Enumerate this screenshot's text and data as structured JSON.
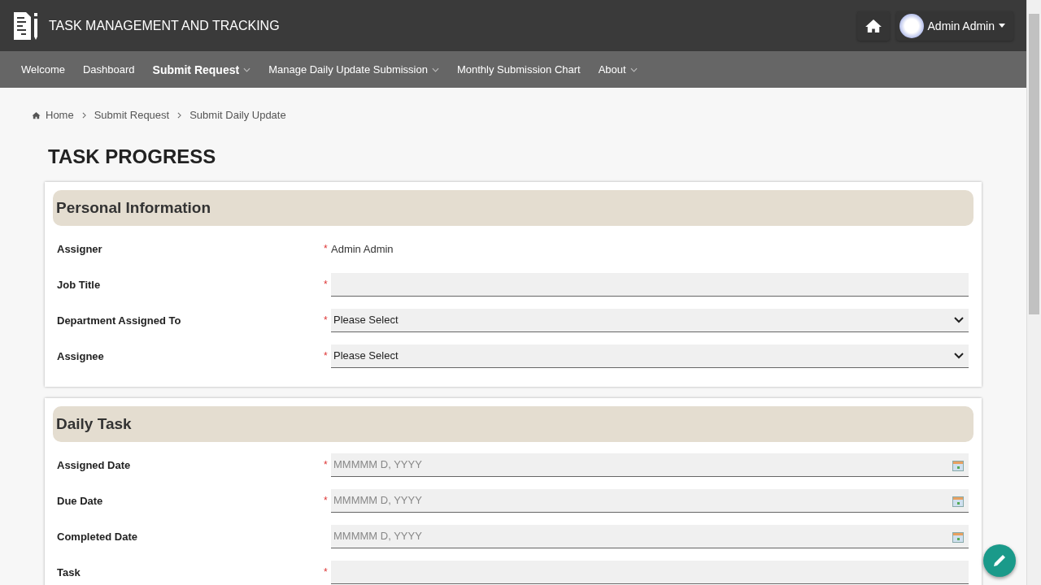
{
  "header": {
    "title": "TASK MANAGEMENT AND TRACKING",
    "user": "Admin Admin"
  },
  "nav": [
    {
      "label": "Welcome",
      "selected": false,
      "dropdown": false
    },
    {
      "label": "Dashboard",
      "selected": false,
      "dropdown": false
    },
    {
      "label": "Submit Request",
      "selected": true,
      "dropdown": true
    },
    {
      "label": "Manage Daily Update Submission",
      "selected": false,
      "dropdown": true
    },
    {
      "label": "Monthly Submission Chart",
      "selected": false,
      "dropdown": false
    },
    {
      "label": "About",
      "selected": false,
      "dropdown": true
    }
  ],
  "breadcrumb": [
    "Home",
    "Submit Request",
    "Submit Daily Update"
  ],
  "page_title": "TASK PROGRESS",
  "sections": [
    {
      "title": "Personal Information",
      "fields": [
        {
          "label": "Assigner",
          "mark": "*",
          "kind": "static",
          "value": "Admin Admin"
        },
        {
          "label": "Job Title",
          "mark": "*",
          "kind": "text"
        },
        {
          "label": "Department Assigned To",
          "mark": "*",
          "kind": "select",
          "value": "Please Select"
        },
        {
          "label": "Assignee",
          "mark": "*",
          "kind": "select",
          "value": "Please Select"
        }
      ]
    },
    {
      "title": "Daily Task",
      "fields": [
        {
          "label": "Assigned Date",
          "mark": "*",
          "kind": "date",
          "placeholder": "MMMMM D, YYYY"
        },
        {
          "label": "Due Date",
          "mark": "*",
          "kind": "date",
          "placeholder": "MMMMM D, YYYY"
        },
        {
          "label": "Completed Date",
          "kind": "date",
          "placeholder": "MMMMM D, YYYY"
        },
        {
          "label": "Task",
          "mark": "*",
          "kind": "text"
        }
      ]
    }
  ]
}
